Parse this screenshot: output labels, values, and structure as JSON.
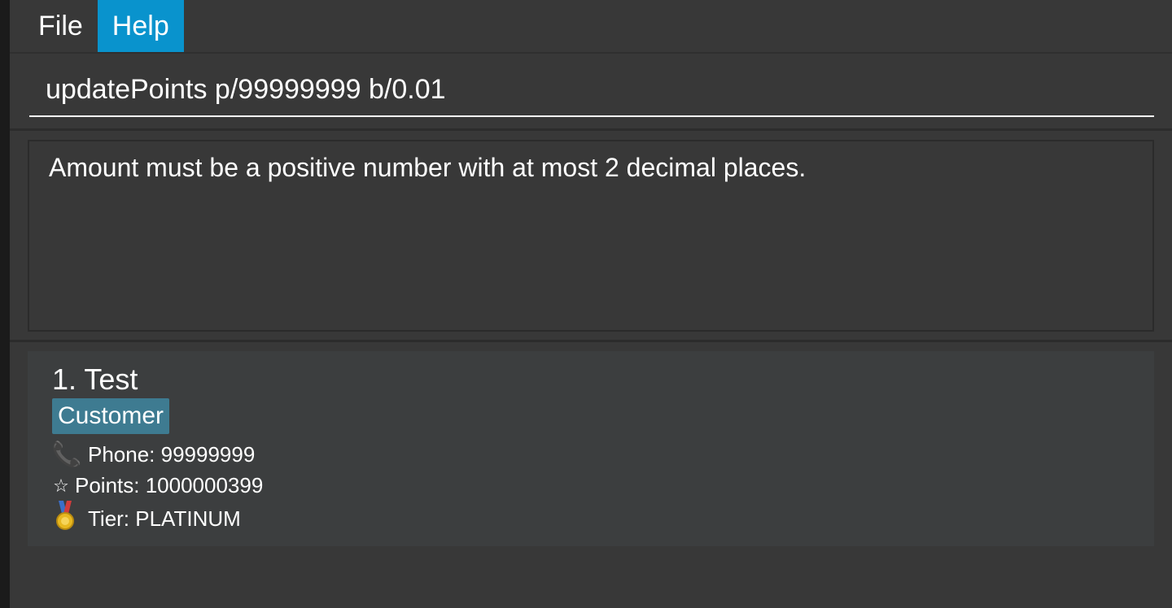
{
  "menu": {
    "file_label": "File",
    "help_label": "Help",
    "active_color": "#0993cd"
  },
  "command": {
    "value": "updatePoints p/99999999 b/0.01"
  },
  "result": {
    "message": "Amount must be a positive number with at most 2 decimal places."
  },
  "customers": [
    {
      "index_name": "1. Test",
      "tag": "Customer",
      "phone_label": "Phone: 99999999",
      "points_label": "Points: 1000000399",
      "tier_label": "Tier: PLATINUM",
      "icons": {
        "phone": "phone-icon",
        "points": "star-icon",
        "tier": "medal-icon"
      }
    }
  ],
  "colors": {
    "background": "#383838",
    "card": "#3c3e3f",
    "tag": "#3e7b91"
  }
}
